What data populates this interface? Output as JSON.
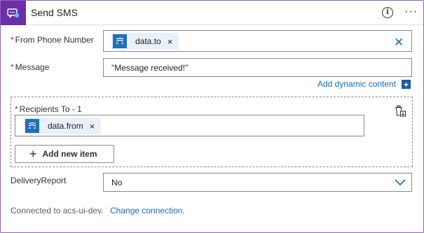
{
  "header": {
    "title": "Send SMS",
    "info_icon": "info-icon",
    "more_icon": "more-options-icon",
    "more_glyph": "···",
    "accent_color": "#6b2fa8"
  },
  "from_phone": {
    "required_mark": "*",
    "label": "From Phone Number",
    "token_text": "data.to",
    "token_remove": "×",
    "clear_glyph": "✕"
  },
  "message": {
    "required_mark": "*",
    "label": "Message",
    "value": "\"Message received!\""
  },
  "dynamic_content": {
    "link_text": "Add dynamic content",
    "plus_glyph": "+"
  },
  "recipients": {
    "required_mark": "*",
    "label": "Recipients To - 1",
    "token_text": "data.from",
    "token_remove": "×",
    "add_button_plus": "+",
    "add_button_label": "Add new item"
  },
  "delivery_report": {
    "label": "DeliveryReport",
    "selected_value": "No"
  },
  "footer": {
    "connection_text": "Connected to acs-ui-dev.",
    "change_link": "Change connection."
  },
  "colors": {
    "link": "#0f6cbd",
    "token_bg": "#e8f1fb",
    "token_icon_bg": "#1e6fb8",
    "required": "#a4262c"
  }
}
